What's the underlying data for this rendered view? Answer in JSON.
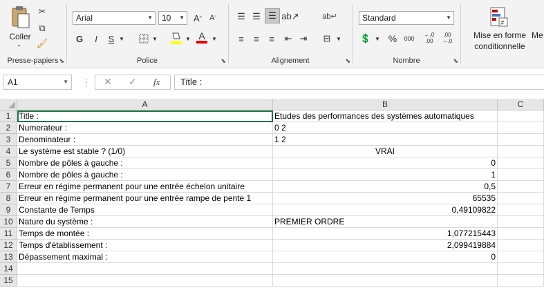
{
  "ribbon": {
    "clipboard": {
      "paste_label": "Coller",
      "group_label": "Presse-papiers"
    },
    "font": {
      "name": "Arial",
      "size": "10",
      "bold": "G",
      "italic": "I",
      "underline": "S",
      "group_label": "Police"
    },
    "alignment": {
      "group_label": "Alignement"
    },
    "number": {
      "format": "Standard",
      "group_label": "Nombre",
      "percent": "%",
      "thousands": "000",
      "inc_decimal": "←,0 ,00",
      "dec_decimal": ",00 →,0"
    },
    "styles": {
      "conditional_label_1": "Mise en forme",
      "conditional_label_2": "conditionnelle",
      "next_label": "Me"
    }
  },
  "formula_bar": {
    "name_box": "A1",
    "fx": "fx",
    "content": "Title :"
  },
  "columns": [
    {
      "name": "A"
    },
    {
      "name": "B"
    },
    {
      "name": "C"
    }
  ],
  "rows": [
    {
      "n": "1",
      "a": "Title :",
      "b": "Etudes des performances des systèmes automatiques",
      "b_align": "left"
    },
    {
      "n": "2",
      "a": "Numerateur :",
      "b": "0  2",
      "b_align": "left"
    },
    {
      "n": "3",
      "a": "Denominateur :",
      "b": "1  2",
      "b_align": "left"
    },
    {
      "n": "4",
      "a": "Le système est stable ? (1/0)",
      "b": "VRAI",
      "b_align": "center"
    },
    {
      "n": "5",
      "a": "Nombre de pôles à gauche :",
      "b": "0",
      "b_align": "right"
    },
    {
      "n": "6",
      "a": "Nombre de pôles à gauche :",
      "b": "1",
      "b_align": "right"
    },
    {
      "n": "7",
      "a": "Erreur en régime permanent pour une entrée échelon unitaire",
      "b": "0,5",
      "b_align": "right"
    },
    {
      "n": "8",
      "a": "Erreur en régime permanent pour une entrée rampe de pente 1",
      "b": "65535",
      "b_align": "right"
    },
    {
      "n": "9",
      "a": "Constante de Temps",
      "b": "0,49109822",
      "b_align": "right"
    },
    {
      "n": "10",
      "a": "Nature du système :",
      "b": "PREMIER ORDRE",
      "b_align": "left"
    },
    {
      "n": "11",
      "a": "Temps de montée :",
      "b": "1,077215443",
      "b_align": "right"
    },
    {
      "n": "12",
      "a": "Temps d'établissement :",
      "b": "2,099419884",
      "b_align": "right"
    },
    {
      "n": "13",
      "a": "Dépassement maximal :",
      "b": "0",
      "b_align": "right"
    },
    {
      "n": "14",
      "a": "",
      "b": "",
      "b_align": "left"
    },
    {
      "n": "15",
      "a": "",
      "b": "",
      "b_align": "left"
    }
  ]
}
